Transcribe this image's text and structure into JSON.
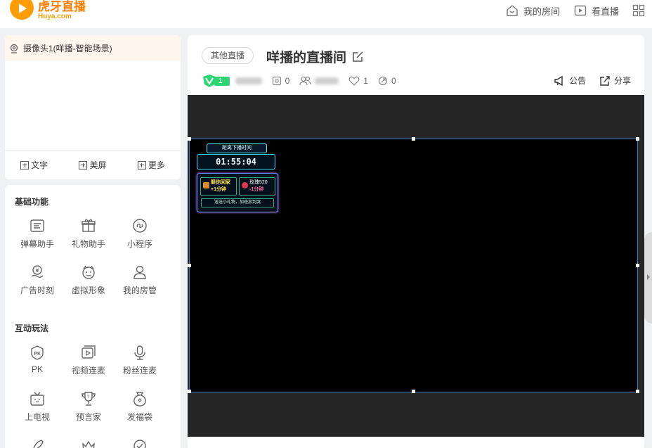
{
  "header": {
    "logo_main": "虎牙直播",
    "logo_sub": "Huya.com",
    "my_room": "我的房间",
    "watch_live": "看直播"
  },
  "sources": {
    "active_item": "摄像头1(咩播-智能场景)",
    "add_text": "文字",
    "add_beauty": "美屏",
    "add_more": "更多"
  },
  "functions": {
    "basic_title": "基础功能",
    "basic": [
      "弹幕助手",
      "礼物助手",
      "小程序",
      "广告时刻",
      "虚拟形象",
      "我的房管"
    ],
    "interactive_title": "互动玩法",
    "interactive": [
      "PK",
      "视频连麦",
      "粉丝连麦",
      "上电视",
      "预言家",
      "发福袋"
    ]
  },
  "room": {
    "category": "其他直播",
    "title": "咩播的直播间",
    "fan_level": "1",
    "stat_room": "0",
    "stat_like": "1",
    "stat_share": "0",
    "notice": "公告",
    "share": "分享"
  },
  "widget": {
    "header": "距离下播时间",
    "timer": "01:55:04",
    "gift1_name": "娶你回家",
    "gift1_time": "+1分钟",
    "gift2_name": "玫瑰520",
    "gift2_time": "-1分钟",
    "tip": "送送小礼物，加班加到哭"
  },
  "colors": {
    "brand": "#ff9d00",
    "level_badge": "#2ed573",
    "selection_border": "#2d7dd2"
  }
}
